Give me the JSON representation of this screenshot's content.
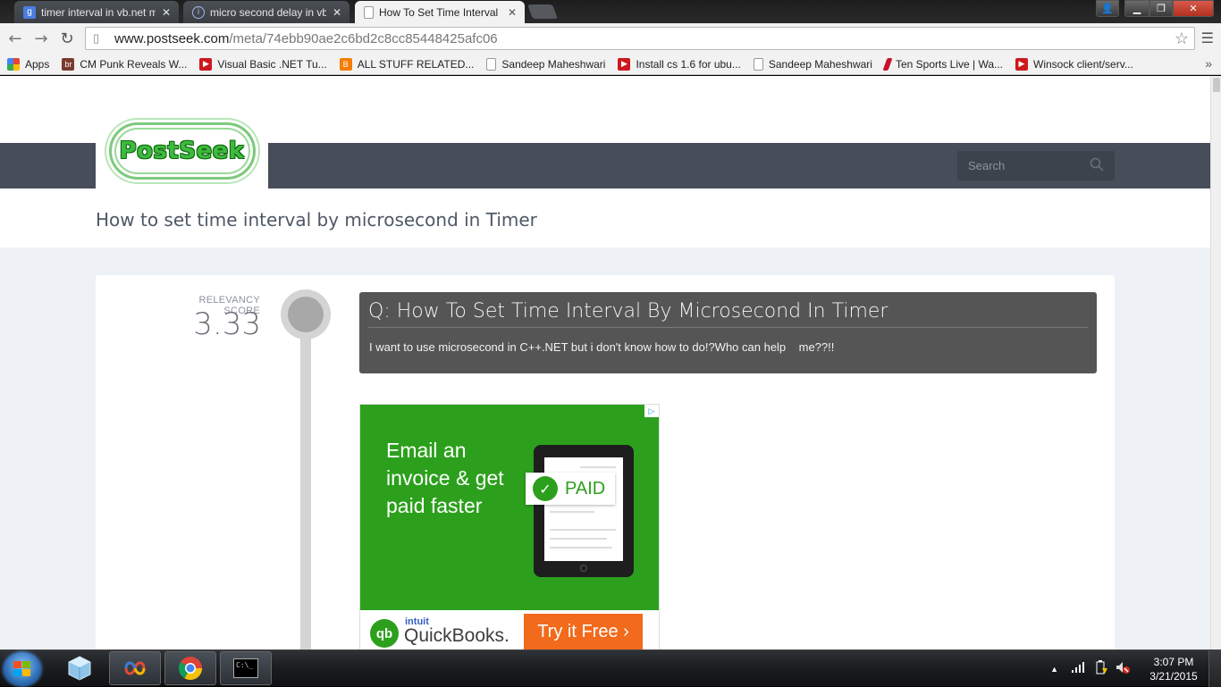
{
  "browser": {
    "tabs": [
      {
        "title": "timer interval in vb.net mi",
        "favicon": "google-g-icon",
        "active": false
      },
      {
        "title": "micro second delay in vb",
        "favicon": "info-icon",
        "active": false
      },
      {
        "title": "How To Set Time Interval",
        "favicon": "page-icon",
        "active": true
      }
    ],
    "url_host": "www.postseek.com",
    "url_path": "/meta/74ebb90ae2c6bd2c8cc85448425afc06",
    "bookmarks": [
      {
        "label": "Apps",
        "icon": "apps-grid-icon",
        "color": "#e94235"
      },
      {
        "label": "CM Punk Reveals W...",
        "icon": "br-site-icon",
        "color": "#7a3b2e"
      },
      {
        "label": "Visual Basic .NET Tu...",
        "icon": "youtube-icon",
        "color": "#cc181e"
      },
      {
        "label": "ALL STUFF RELATED...",
        "icon": "blogger-icon",
        "color": "#f57d00"
      },
      {
        "label": "Sandeep Maheshwari",
        "icon": "page-icon",
        "color": "#ffffff"
      },
      {
        "label": "Install cs 1.6 for ubu...",
        "icon": "youtube-icon",
        "color": "#cc181e"
      },
      {
        "label": "Sandeep Maheshwari",
        "icon": "page-icon",
        "color": "#ffffff"
      },
      {
        "label": "Ten Sports Live | Wa...",
        "icon": "sports-icon",
        "color": "#c8102e"
      },
      {
        "label": "Winsock client/serv...",
        "icon": "youtube-icon",
        "color": "#cc181e"
      }
    ],
    "bookmarks_more": "»"
  },
  "site": {
    "logo_text": "PostSeek",
    "search_placeholder": "Search",
    "page_title": "How to set time interval by microsecond in Timer"
  },
  "result": {
    "relevancy_label": "RELEVANCY SCORE",
    "relevancy_score": "3.33",
    "question_title": "Q: How To Set Time Interval By Microsecond In Timer",
    "question_body": "I want to use microsecond in C++.NET but i don't know how to do!?Who can help    me??!!"
  },
  "ad": {
    "headline": "Email an invoice & get paid faster",
    "badge": "PAID",
    "brand_small": "intuit",
    "brand_name": "QuickBooks.",
    "cta": "Try it Free ›",
    "adchoices": "▷"
  },
  "taskbar": {
    "time": "3:07 PM",
    "date": "3/21/2015"
  },
  "colors": {
    "navbar": "#474e59",
    "ad_green": "#2ca01c",
    "cta_orange": "#f26a1b",
    "question_bg": "#555555"
  }
}
